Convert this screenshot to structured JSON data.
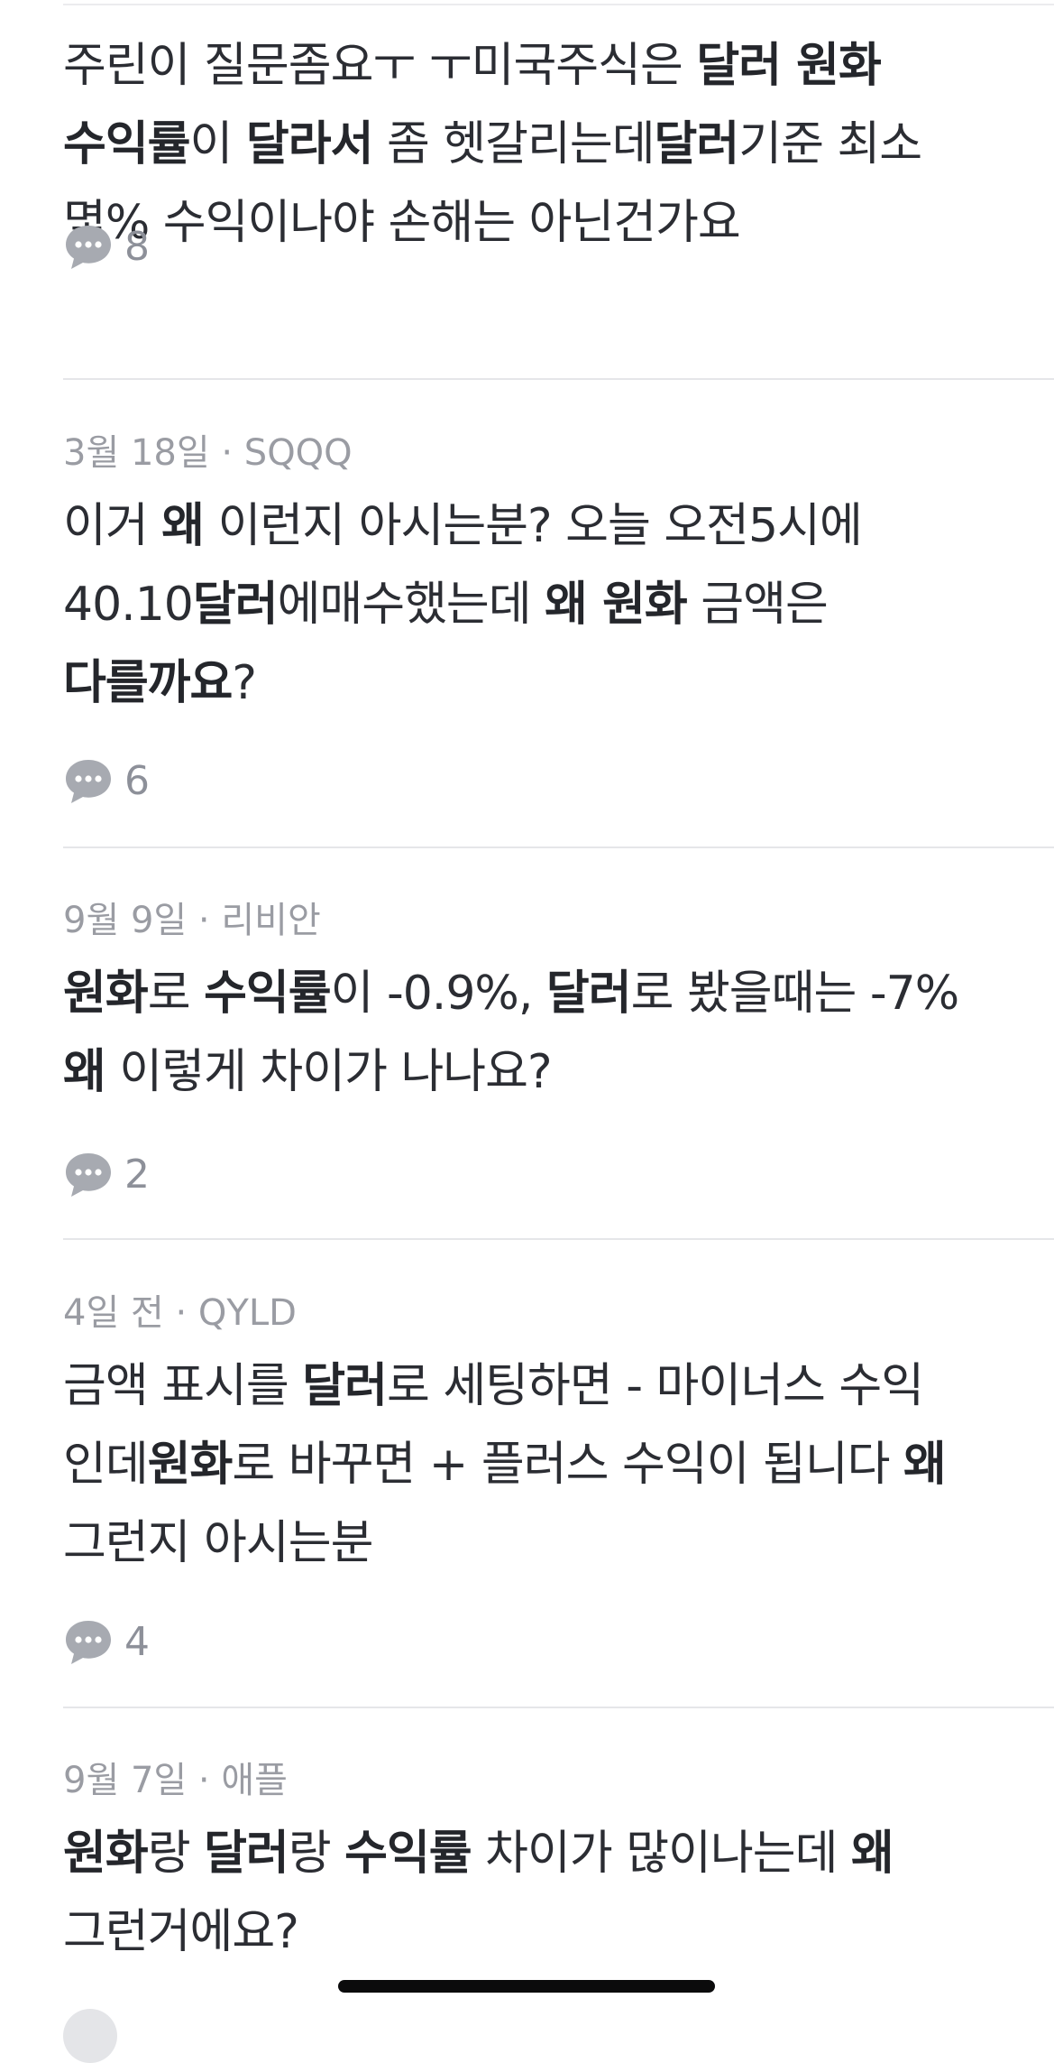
{
  "posts": [
    {
      "meta": "",
      "title": [
        {
          "t": "주린이 질문좀요ㅜ ㅜ미국주식은 ",
          "b": false
        },
        {
          "t": "달러 원화 수익률",
          "b": true
        },
        {
          "t": "이 ",
          "b": false
        },
        {
          "t": "달라서",
          "b": true
        },
        {
          "t": " 좀 헷갈리는데",
          "b": false
        },
        {
          "t": "달러",
          "b": true
        },
        {
          "t": "기준 최소 몇% 수익이나야 손해는 아닌건가요",
          "b": false
        }
      ],
      "comments": "8"
    },
    {
      "meta": "3월 18일 · SQQQ",
      "title": [
        {
          "t": "이거 ",
          "b": false
        },
        {
          "t": "왜",
          "b": true
        },
        {
          "t": " 이런지 아시는분? 오늘 오전5시에 40.10",
          "b": false
        },
        {
          "t": "달러",
          "b": true
        },
        {
          "t": "에매수했는데 ",
          "b": false
        },
        {
          "t": "왜 원화",
          "b": true
        },
        {
          "t": " 금액은 ",
          "b": false
        },
        {
          "t": "다를까요",
          "b": true
        },
        {
          "t": "?",
          "b": false
        }
      ],
      "comments": "6"
    },
    {
      "meta": "9월 9일 · 리비안",
      "title": [
        {
          "t": "원화",
          "b": true
        },
        {
          "t": "로 ",
          "b": false
        },
        {
          "t": "수익률",
          "b": true
        },
        {
          "t": "이 -0.9%, ",
          "b": false
        },
        {
          "t": "달러",
          "b": true
        },
        {
          "t": "로 봤을때는 -7% ",
          "b": false
        },
        {
          "t": "왜",
          "b": true
        },
        {
          "t": " 이렇게 차이가 나나요?",
          "b": false
        }
      ],
      "comments": "2"
    },
    {
      "meta": "4일 전 · QYLD",
      "title": [
        {
          "t": "금액 표시를 ",
          "b": false
        },
        {
          "t": "달러",
          "b": true
        },
        {
          "t": "로 세팅하면 - 마이너스 수익 인데",
          "b": false
        },
        {
          "t": "원화",
          "b": true
        },
        {
          "t": "로 바꾸면 + 플러스 수익이 됩니다 ",
          "b": false
        },
        {
          "t": "왜",
          "b": true
        },
        {
          "t": " 그런지 아시는분",
          "b": false
        }
      ],
      "comments": "4"
    },
    {
      "meta": "9월 7일 · 애플",
      "title": [
        {
          "t": "원화",
          "b": true
        },
        {
          "t": "랑 ",
          "b": false
        },
        {
          "t": "달러",
          "b": true
        },
        {
          "t": "랑 ",
          "b": false
        },
        {
          "t": "수익률",
          "b": true
        },
        {
          "t": " 차이가 많이나는데 ",
          "b": false
        },
        {
          "t": "왜",
          "b": true
        },
        {
          "t": " 그런거에요?",
          "b": false
        }
      ],
      "comments": ""
    }
  ],
  "icons": {
    "comment": "speech-bubble-icon"
  },
  "colors": {
    "text": "#2b2d33",
    "meta": "#9a9ca3",
    "icon": "#a7aab1",
    "divider": "#e5e6e9"
  }
}
